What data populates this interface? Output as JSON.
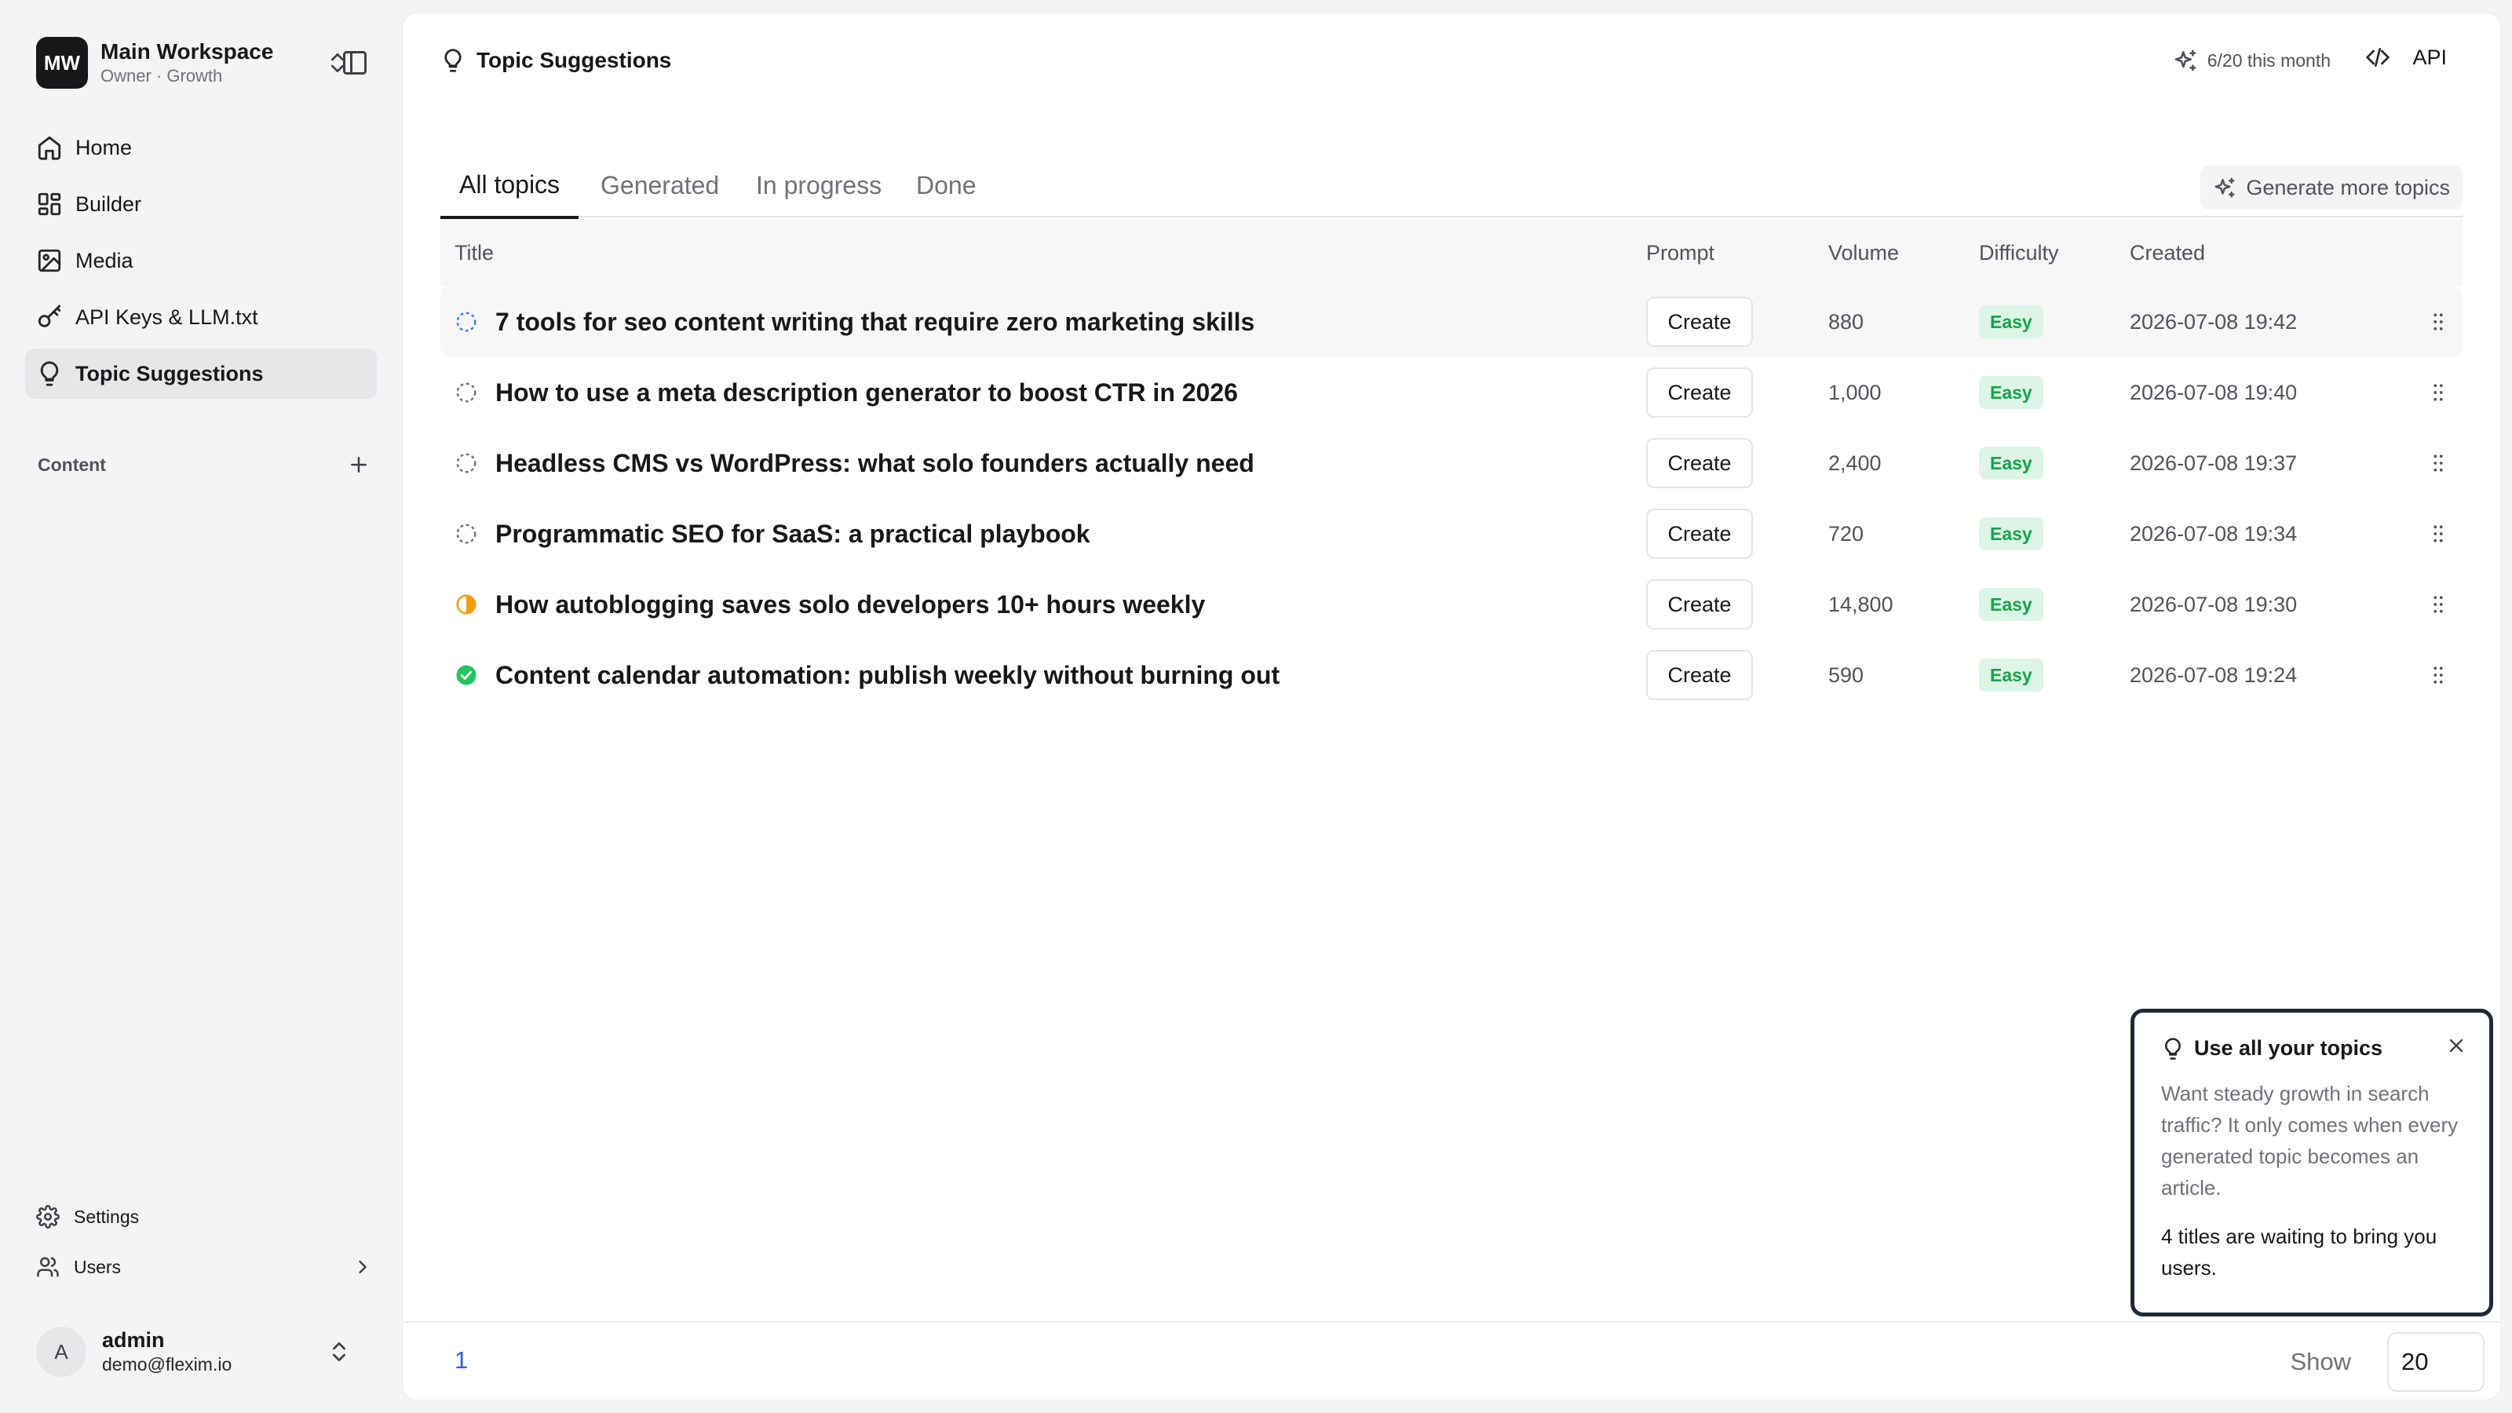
{
  "workspace": {
    "initials": "MW",
    "name": "Main Workspace",
    "subtitle": "Owner · Growth"
  },
  "sidebar": {
    "items": [
      {
        "label": "Home",
        "icon": "home-icon"
      },
      {
        "label": "Builder",
        "icon": "grid-icon"
      },
      {
        "label": "Media",
        "icon": "image-icon"
      },
      {
        "label": "API Keys & LLM.txt",
        "icon": "key-icon"
      },
      {
        "label": "Topic Suggestions",
        "icon": "lightbulb-icon",
        "active": true
      }
    ],
    "content_label": "Content",
    "bottom": [
      {
        "label": "Settings",
        "icon": "gear-icon"
      },
      {
        "label": "Users",
        "icon": "users-icon"
      }
    ]
  },
  "user": {
    "initial": "A",
    "name": "admin",
    "email": "demo@flexim.io"
  },
  "header": {
    "title": "Topic Suggestions",
    "usage": "6/20 this month",
    "api_label": "API"
  },
  "tabs": [
    {
      "label": "All topics",
      "active": true
    },
    {
      "label": "Generated"
    },
    {
      "label": "In progress"
    },
    {
      "label": "Done"
    }
  ],
  "generate_label": "Generate more topics",
  "table": {
    "columns": [
      "Title",
      "Prompt",
      "Volume",
      "Difficulty",
      "Created"
    ],
    "rows": [
      {
        "status": "generating",
        "title": "7 tools for seo content writing that require zero marketing skills",
        "prompt": "Create",
        "volume": "880",
        "difficulty": "Easy",
        "created": "2026-07-08 19:42"
      },
      {
        "status": "pending",
        "title": "How to use a meta description generator to boost CTR in 2026",
        "prompt": "Create",
        "volume": "1,000",
        "difficulty": "Easy",
        "created": "2026-07-08 19:40"
      },
      {
        "status": "pending",
        "title": "Headless CMS vs WordPress: what solo founders actually need",
        "prompt": "Create",
        "volume": "2,400",
        "difficulty": "Easy",
        "created": "2026-07-08 19:37"
      },
      {
        "status": "pending",
        "title": "Programmatic SEO for SaaS: a practical playbook",
        "prompt": "Create",
        "volume": "720",
        "difficulty": "Easy",
        "created": "2026-07-08 19:34"
      },
      {
        "status": "in-progress",
        "title": "How autoblogging saves solo developers 10+ hours weekly",
        "prompt": "Create",
        "volume": "14,800",
        "difficulty": "Easy",
        "created": "2026-07-08 19:30"
      },
      {
        "status": "done",
        "title": "Content calendar automation: publish weekly without burning out",
        "prompt": "Create",
        "volume": "590",
        "difficulty": "Easy",
        "created": "2026-07-08 19:24"
      }
    ]
  },
  "pagination": {
    "current_page": "1",
    "show_label": "Show",
    "page_size": "20"
  },
  "popup": {
    "title": "Use all your topics",
    "body": "Want steady growth in search traffic? It only comes when every generated topic becomes an article.",
    "footer": "4 titles are waiting to bring you users."
  },
  "colors": {
    "accent": "#2563eb",
    "easy_badge_bg": "#dcf5e6",
    "easy_badge_text": "#16a34a",
    "in_progress": "#f59e0b",
    "done": "#22c55e",
    "generating": "#3b82f6"
  }
}
